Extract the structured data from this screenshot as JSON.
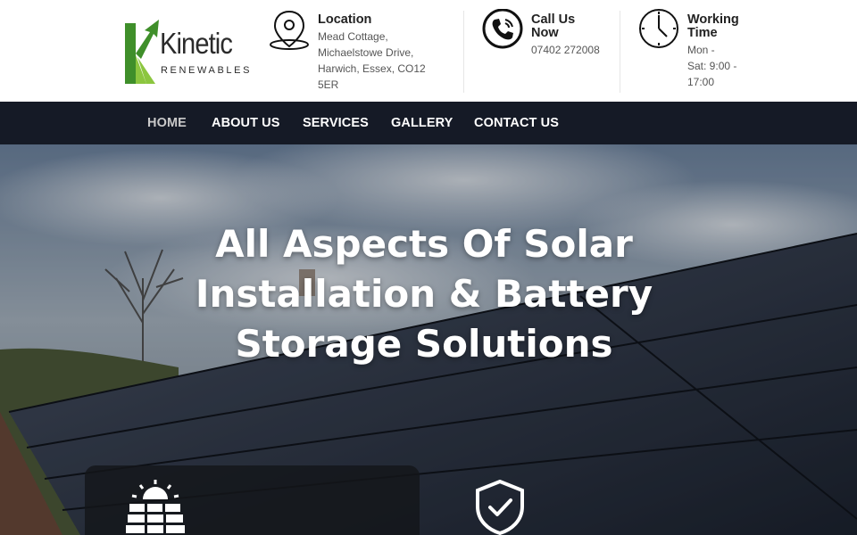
{
  "brand": {
    "name": "Kinetic",
    "sub": "RENEWABLES",
    "colors": {
      "green_dark": "#3f8f2a",
      "green_light": "#8cc63f",
      "nav_bg": "#151a26"
    }
  },
  "header": {
    "location": {
      "icon": "map-pin-icon",
      "title": "Location",
      "lines": [
        "Mead Cottage,",
        "Michaelstowe Drive,",
        "Harwich, Essex, CO12",
        "5ER"
      ]
    },
    "call": {
      "icon": "phone-icon",
      "title_lines": [
        "Call Us",
        "Now"
      ],
      "phone": "07402 272008"
    },
    "hours": {
      "icon": "clock-icon",
      "title_lines": [
        "Working",
        "Time"
      ],
      "lines": [
        "Mon -",
        "Sat: 9:00 -",
        "17:00"
      ]
    }
  },
  "nav": {
    "items": [
      "HOME",
      "ABOUT US",
      "SERVICES",
      "GALLERY",
      "CONTACT US"
    ],
    "active": "HOME"
  },
  "hero": {
    "title_lines": [
      "All Aspects Of Solar",
      "Installation & Battery",
      "Storage Solutions"
    ],
    "cards": [
      {
        "icon": "solar-panel-icon"
      },
      {
        "icon": "shield-check-icon"
      }
    ]
  }
}
